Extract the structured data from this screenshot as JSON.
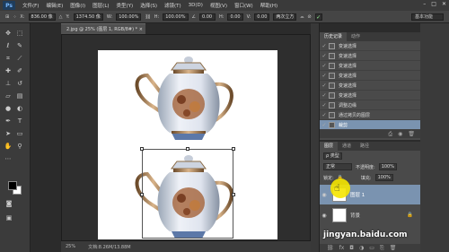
{
  "app": {
    "logo": "Ps",
    "menu": [
      "文件(F)",
      "编辑(E)",
      "图像(I)",
      "图层(L)",
      "类型(Y)",
      "选择(S)",
      "滤镜(T)",
      "3D(D)",
      "视图(V)",
      "窗口(W)",
      "帮助(H)"
    ],
    "window_controls": [
      "–",
      "□",
      "✕"
    ]
  },
  "options_bar": {
    "x_label": "X:",
    "x_value": "836.00 像",
    "y_label": "Y:",
    "y_value": "1374.50 像",
    "w_label": "W:",
    "w_value": "100.00%",
    "h_label": "H:",
    "h_value": "100.00%",
    "angle_value": "0.00",
    "hskew_label": "H:",
    "hskew_value": "0.00",
    "vskew_label": "V:",
    "vskew_value": "0.00",
    "interp_value": "两次立方",
    "workspace": "基本功能"
  },
  "document": {
    "tab": "2.jpg @ 25% (图层 1, RGB/8#) * ×",
    "zoom": "25%",
    "doc_info": "文档:8.26M/13.88M"
  },
  "history": {
    "tabs": [
      "历史记录",
      "动作"
    ],
    "items": [
      {
        "label": "变速选择",
        "selected": false
      },
      {
        "label": "变速选择",
        "selected": false
      },
      {
        "label": "变速选择",
        "selected": false
      },
      {
        "label": "变速选择",
        "selected": false
      },
      {
        "label": "变速选择",
        "selected": false
      },
      {
        "label": "变速选择",
        "selected": false
      },
      {
        "label": "调整边缘",
        "selected": false
      },
      {
        "label": "通过拷贝的图层",
        "selected": false
      },
      {
        "label": "裁剪",
        "selected": true
      }
    ]
  },
  "layers": {
    "tabs": [
      "图层",
      "通道",
      "路径"
    ],
    "kind": "ρ 类型",
    "blend_mode": "正常",
    "opacity_label": "不透明度:",
    "opacity_value": "100%",
    "lock_label": "锁定:",
    "fill_label": "填充:",
    "fill_value": "100%",
    "items": [
      {
        "name": "图层 1",
        "selected": true
      },
      {
        "name": "背景",
        "selected": false
      }
    ]
  },
  "watermark": "jingyan.baidu.com"
}
